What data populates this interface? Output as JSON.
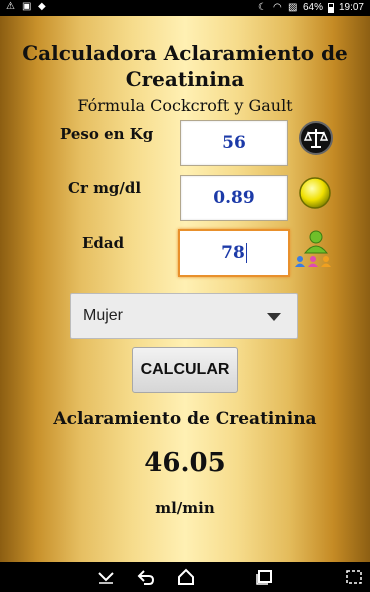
{
  "status_bar": {
    "battery_text": "64%",
    "time": "19:07"
  },
  "app": {
    "title": "Calculadora Aclaramiento de Creatinina",
    "subtitle": "Fórmula Cockcroft y Gault",
    "fields": {
      "weight": {
        "label": "Peso en Kg",
        "value": "56",
        "icon": "scale-icon"
      },
      "creatinine": {
        "label": "Cr mg/dl",
        "value": "0.89",
        "icon": "yellow-circle-icon"
      },
      "age": {
        "label": "Edad",
        "value": "78",
        "icon": "people-icon"
      }
    },
    "sex_select": {
      "selected": "Mujer"
    },
    "calculate_label": "CALCULAR",
    "result": {
      "title": "Aclaramiento de Creatinina",
      "value": "46.05",
      "unit": "ml/min"
    }
  },
  "colors": {
    "gold_light": "#fff0b3",
    "gold_dark": "#8c5e12",
    "value_blue": "#1c3aa8",
    "active_border": "#e8902c"
  }
}
